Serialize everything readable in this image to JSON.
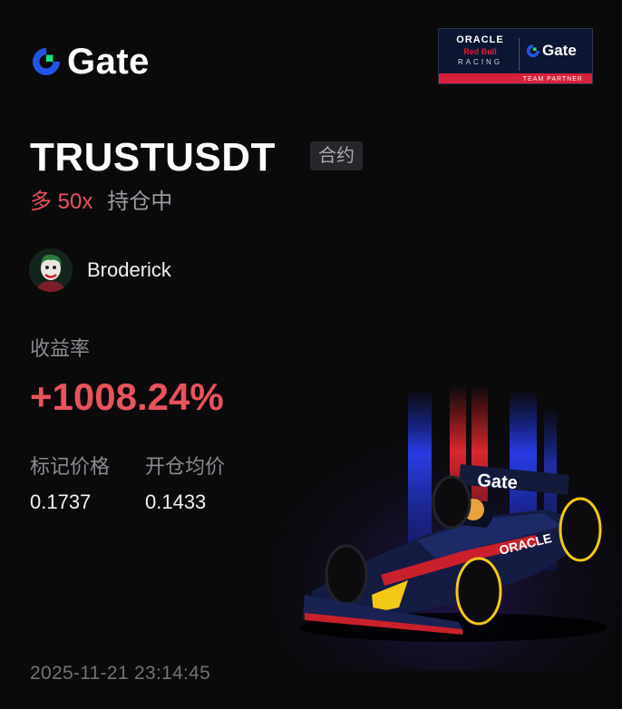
{
  "brand": {
    "name": "Gate",
    "accent": "#2354e6",
    "green": "#17e07a"
  },
  "partner": {
    "line1": "ORACLE",
    "line2": "Red Bull",
    "line3": "RACING",
    "gate": "Gate",
    "strip": "TEAM PARTNER"
  },
  "position": {
    "symbol": "TRUSTUSDT",
    "type_tag": "合约",
    "direction": "多 50x",
    "status": "持仓中"
  },
  "user": {
    "name": "Broderick",
    "avatar": "avatar-icon"
  },
  "pnl": {
    "label": "收益率",
    "value": "+1008.24%",
    "color": "#e8535d"
  },
  "mark_price": {
    "label": "标记价格",
    "value": "0.1737"
  },
  "open_price": {
    "label": "开仓均价",
    "value": "0.1433"
  },
  "timestamp": "2025-11-21 23:14:45",
  "car": {
    "livery_text": "Gate",
    "sponsor": "ORACLE"
  }
}
